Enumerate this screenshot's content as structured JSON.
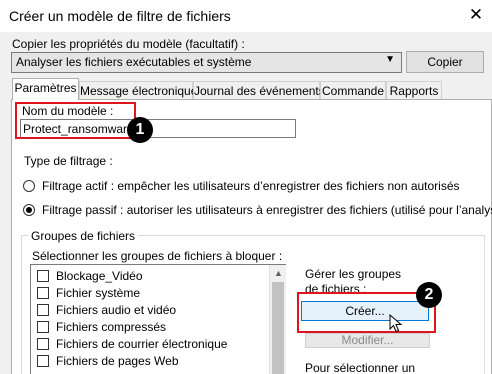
{
  "window": {
    "title": "Créer un modèle de filtre de fichiers",
    "close_glyph": "✕"
  },
  "copy": {
    "label": "Copier les propriétés du modèle (facultatif) :",
    "selected": "Analyser les fichiers exécutables et système",
    "button": "Copier"
  },
  "tabs": [
    {
      "label": "Paramètres"
    },
    {
      "label": "Message électronique"
    },
    {
      "label": "Journal des événements"
    },
    {
      "label": "Commande"
    },
    {
      "label": "Rapports"
    }
  ],
  "template": {
    "label": "Nom du modèle :",
    "value": "Protect_ransomware"
  },
  "filtering": {
    "label": "Type de filtrage :",
    "active": "Filtrage actif : empêcher les utilisateurs d’enregistrer des fichiers non autorisés",
    "passive": "Filtrage passif : autoriser les utilisateurs à enregistrer des fichiers (utilisé pour l’analyse)"
  },
  "file_groups": {
    "title": "Groupes de fichiers",
    "select_label": "Sélectionner les groupes de fichiers à bloquer :",
    "items": [
      "Blockage_Vidéo",
      "Fichier système",
      "Fichiers audio et vidéo",
      "Fichiers compressés",
      "Fichiers de courrier électronique",
      "Fichiers de pages Web"
    ],
    "manage_label": "Gérer les groupes de fichiers :",
    "create_button": "Créer...",
    "modify_button": "Modifier...",
    "select_hint": "Pour sélectionner un"
  },
  "badges": [
    "1",
    "2"
  ],
  "colors": {
    "highlight": "#e0141e",
    "badge": "#000000",
    "focus": "#0078d7"
  }
}
